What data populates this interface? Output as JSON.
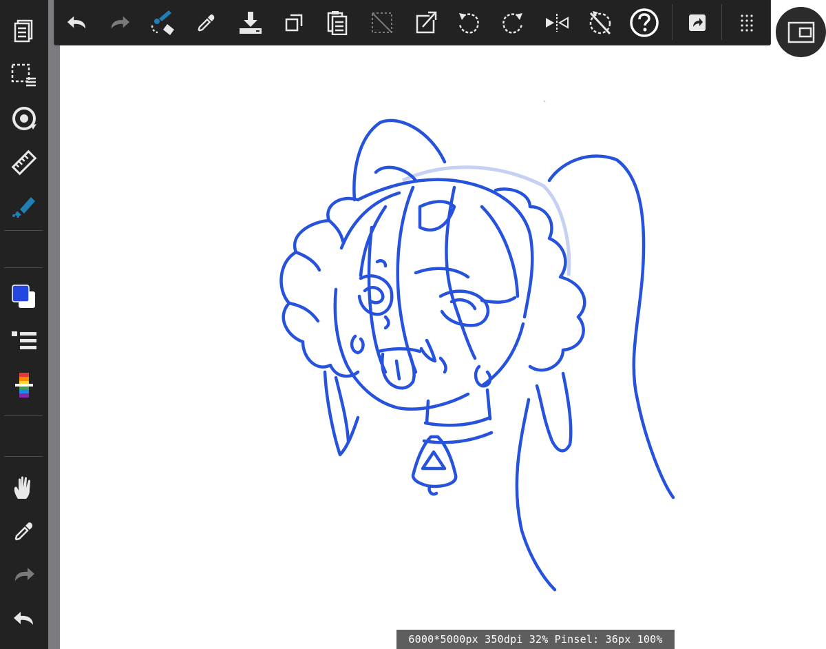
{
  "colors": {
    "toolbar_bg": "#222222",
    "icon": "#e8e8e8",
    "icon_disabled": "#7a7a7a",
    "accent": "#1f7fb6",
    "primary_color": "#2447e0",
    "secondary_color": "#ffffff",
    "line_art": "#2652dc",
    "guide_circle": "#c6d0f2"
  },
  "left_toolbar": {
    "items": [
      {
        "icon": "layers-icon",
        "state": "normal"
      },
      {
        "icon": "selection-layer-icon",
        "state": "normal"
      },
      {
        "icon": "rotate-canvas-icon",
        "state": "normal"
      },
      {
        "icon": "ruler-icon",
        "state": "normal"
      },
      {
        "icon": "brush-tool-icon",
        "state": "active"
      },
      {
        "icon": "color-swatch-icon",
        "state": "normal"
      },
      {
        "icon": "brush-settings-icon",
        "state": "normal"
      },
      {
        "icon": "color-picker-spectrum-icon",
        "state": "normal"
      },
      {
        "icon": "hand-pan-icon",
        "state": "normal"
      },
      {
        "icon": "eyedropper-icon",
        "state": "normal"
      },
      {
        "icon": "redo-icon",
        "state": "disabled"
      },
      {
        "icon": "undo-icon",
        "state": "normal"
      }
    ]
  },
  "top_toolbar": {
    "items": [
      {
        "icon": "undo-icon",
        "state": "normal"
      },
      {
        "icon": "redo-icon",
        "state": "disabled"
      },
      {
        "icon": "brush-eraser-swap-icon",
        "state": "accent"
      },
      {
        "icon": "eyedropper-icon",
        "state": "normal"
      },
      {
        "icon": "save-download-icon",
        "state": "normal"
      },
      {
        "icon": "copy-icon",
        "state": "normal"
      },
      {
        "icon": "paste-icon",
        "state": "normal"
      },
      {
        "icon": "clear-selection-icon",
        "state": "disabled"
      },
      {
        "icon": "transform-icon",
        "state": "normal"
      },
      {
        "icon": "rotate-left-icon",
        "state": "normal"
      },
      {
        "icon": "rotate-right-icon",
        "state": "normal"
      },
      {
        "icon": "flip-horizontal-icon",
        "state": "normal"
      },
      {
        "icon": "reset-rotation-icon",
        "state": "normal"
      },
      {
        "icon": "help-icon",
        "state": "normal"
      },
      {
        "icon": "share-icon",
        "state": "normal"
      },
      {
        "icon": "more-grid-icon",
        "state": "normal"
      }
    ]
  },
  "layout_toggle": {
    "icon": "window-layout-icon"
  },
  "status": {
    "text": "6000*5000px 350dpi 32% Pinsel: 36px 100%"
  }
}
